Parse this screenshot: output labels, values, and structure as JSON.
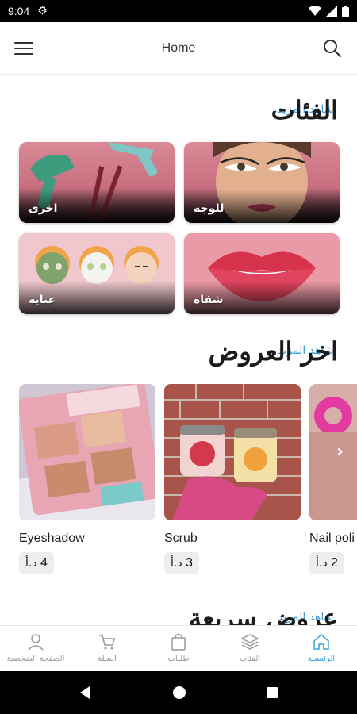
{
  "status_bar": {
    "time": "9:04"
  },
  "app_bar": {
    "title": "Home"
  },
  "categories_section": {
    "title": "الفئات",
    "see_more": "شاهد المزيد",
    "items": [
      {
        "label": "للوجه"
      },
      {
        "label": "اخرى"
      },
      {
        "label": "شفاه"
      },
      {
        "label": "عناية"
      }
    ]
  },
  "offers_section": {
    "title": "اخر العروض",
    "see_more": "شاهد المزيد",
    "items": [
      {
        "name": "Eyeshadow",
        "price": "4",
        "currency": "د.أ"
      },
      {
        "name": "Scrub",
        "price": "3",
        "currency": "د.أ"
      },
      {
        "name": "Nail poli",
        "price": "2",
        "currency": "د.أ"
      }
    ]
  },
  "quick_offers_section": {
    "title": "عروض سريعة",
    "see_more": "شاهد المزيد"
  },
  "bottom_nav": {
    "items": [
      {
        "label": "الرئيسية",
        "icon": "home-icon",
        "active": true
      },
      {
        "label": "الفئات",
        "icon": "layers-icon"
      },
      {
        "label": "طلبات",
        "icon": "bag-icon"
      },
      {
        "label": "السلة",
        "icon": "cart-icon"
      },
      {
        "label": "الصفحة الشخصية",
        "icon": "person-icon"
      }
    ]
  },
  "colors": {
    "accent": "#3aa0d9",
    "card_pink": "#d98a96"
  }
}
